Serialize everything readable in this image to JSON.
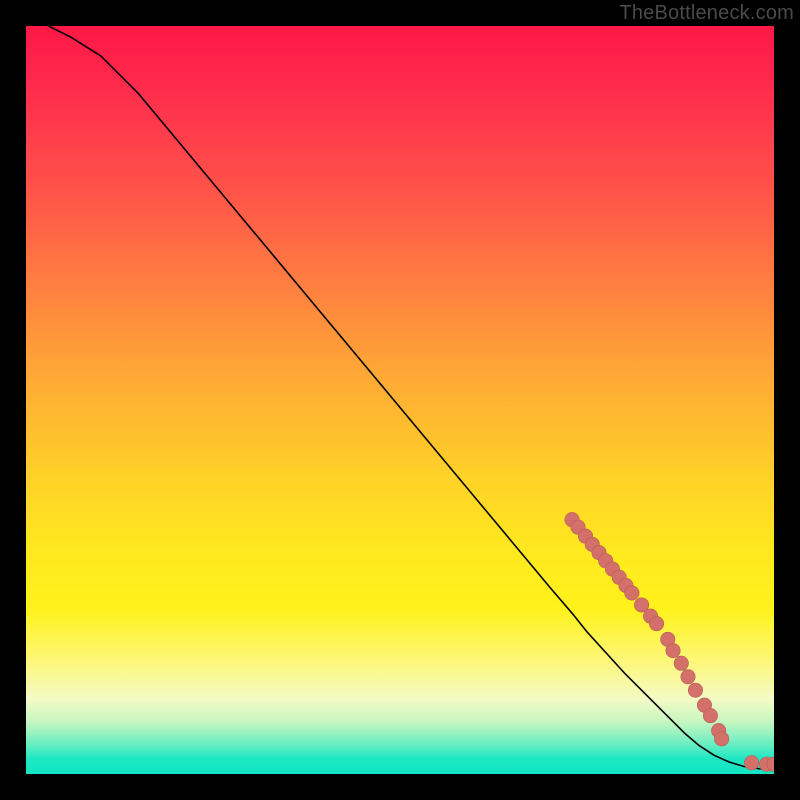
{
  "watermark": "TheBottleneck.com",
  "colors": {
    "frame_bg": "#000000",
    "line": "#000000",
    "marker_fill": "#d37069",
    "marker_stroke": "#b85b56",
    "gradient_top": "#ff1846",
    "gradient_bottom": "#12e6c4"
  },
  "chart_data": {
    "type": "line",
    "title": "",
    "xlabel": "",
    "ylabel": "",
    "xlim": [
      0,
      100
    ],
    "ylim": [
      0,
      100
    ],
    "series": [
      {
        "name": "curve",
        "x": [
          3,
          6,
          10,
          15,
          20,
          25,
          30,
          35,
          40,
          45,
          50,
          55,
          60,
          65,
          70,
          73,
          75,
          80,
          85,
          88,
          90,
          92,
          94,
          96,
          98,
          100
        ],
        "y": [
          100,
          98.5,
          96,
          91,
          85,
          79,
          73,
          67,
          61,
          55,
          49,
          43,
          37,
          31,
          25,
          21.5,
          19,
          13.5,
          8.5,
          5.5,
          3.8,
          2.5,
          1.6,
          1.0,
          0.7,
          0.6
        ]
      }
    ],
    "markers": {
      "name": "data-points",
      "points": [
        {
          "x": 73.0,
          "y": 34.0
        },
        {
          "x": 73.8,
          "y": 33.0
        },
        {
          "x": 74.8,
          "y": 31.8
        },
        {
          "x": 75.7,
          "y": 30.7
        },
        {
          "x": 76.6,
          "y": 29.6
        },
        {
          "x": 77.5,
          "y": 28.5
        },
        {
          "x": 78.4,
          "y": 27.4
        },
        {
          "x": 79.3,
          "y": 26.3
        },
        {
          "x": 80.2,
          "y": 25.2
        },
        {
          "x": 81.0,
          "y": 24.2
        },
        {
          "x": 82.3,
          "y": 22.6
        },
        {
          "x": 83.5,
          "y": 21.1
        },
        {
          "x": 84.3,
          "y": 20.1
        },
        {
          "x": 85.8,
          "y": 18.0
        },
        {
          "x": 86.5,
          "y": 16.5
        },
        {
          "x": 87.6,
          "y": 14.8
        },
        {
          "x": 88.5,
          "y": 13.0
        },
        {
          "x": 89.5,
          "y": 11.2
        },
        {
          "x": 90.7,
          "y": 9.2
        },
        {
          "x": 91.5,
          "y": 7.8
        },
        {
          "x": 92.6,
          "y": 5.8
        },
        {
          "x": 93.0,
          "y": 4.7
        },
        {
          "x": 97.0,
          "y": 1.5
        },
        {
          "x": 99.0,
          "y": 1.3
        },
        {
          "x": 100.0,
          "y": 1.3
        }
      ]
    }
  }
}
